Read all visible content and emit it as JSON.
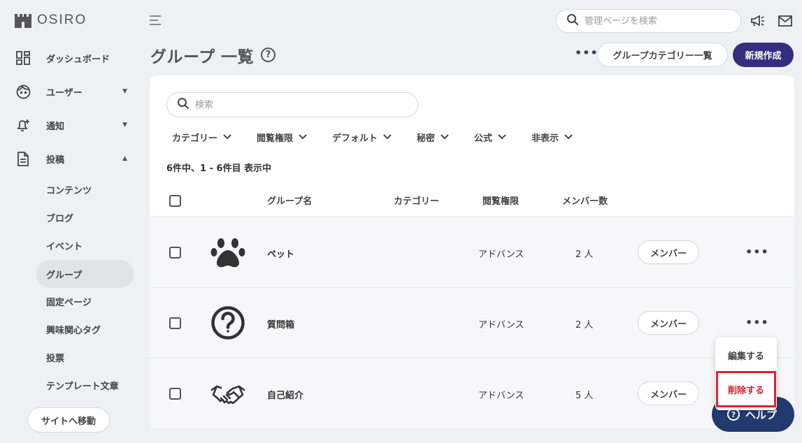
{
  "app": {
    "logo_text": "OSIRO"
  },
  "sidebar": {
    "items": [
      {
        "label": "ダッシュボード",
        "icon": "dashboard-icon"
      },
      {
        "label": "ユーザー",
        "icon": "user-face-icon",
        "caret": "▼"
      },
      {
        "label": "通知",
        "icon": "bell-plus-icon",
        "caret": "▼"
      },
      {
        "label": "投稿",
        "icon": "document-icon",
        "caret": "▲"
      }
    ],
    "sub_items": [
      "コンテンツ",
      "ブログ",
      "イベント",
      "グループ",
      "固定ページ",
      "興味関心タグ",
      "投票",
      "テンプレート文章"
    ],
    "active_sub_item": "グループ",
    "site_button": "サイトへ移動"
  },
  "topbar": {
    "search_placeholder": "管理ページを検索",
    "icons": [
      "hamburger-icon",
      "search-icon",
      "megaphone-icon",
      "mail-icon"
    ]
  },
  "header": {
    "title": "グループ 一覧",
    "help_symbol": "?",
    "more_symbol": "•••",
    "category_button": "グループカテゴリー一覧",
    "new_button": "新規作成"
  },
  "card": {
    "search_placeholder": "検索",
    "filters": [
      "カテゴリー",
      "閲覧権限",
      "デフォルト",
      "秘密",
      "公式",
      "非表示"
    ],
    "count_text": "6件中、1 - 6件目 表示中",
    "columns": {
      "name": "グループ名",
      "category": "カテゴリー",
      "permission": "閲覧権限",
      "members": "メンバー数"
    },
    "rows": [
      {
        "name": "ペット",
        "icon": "paw-icon",
        "category": "",
        "permission": "アドバンス",
        "members": "2 人",
        "member_button": "メンバー",
        "more": "•••"
      },
      {
        "name": "質問箱",
        "icon": "question-circle-icon",
        "category": "",
        "permission": "アドバンス",
        "members": "2 人",
        "member_button": "メンバー",
        "more": "•••"
      },
      {
        "name": "自己紹介",
        "icon": "handshake-icon",
        "category": "",
        "permission": "アドバンス",
        "members": "5 人",
        "member_button": "メンバー",
        "more": "•••"
      }
    ]
  },
  "context_menu": {
    "edit": "編集する",
    "delete": "削除する"
  },
  "help_button": {
    "label": "ヘルプ",
    "symbol": "?"
  },
  "colors": {
    "primary": "#332e7d",
    "help": "#223a6f",
    "danger": "#d0202a",
    "background": "#eef0f4"
  }
}
